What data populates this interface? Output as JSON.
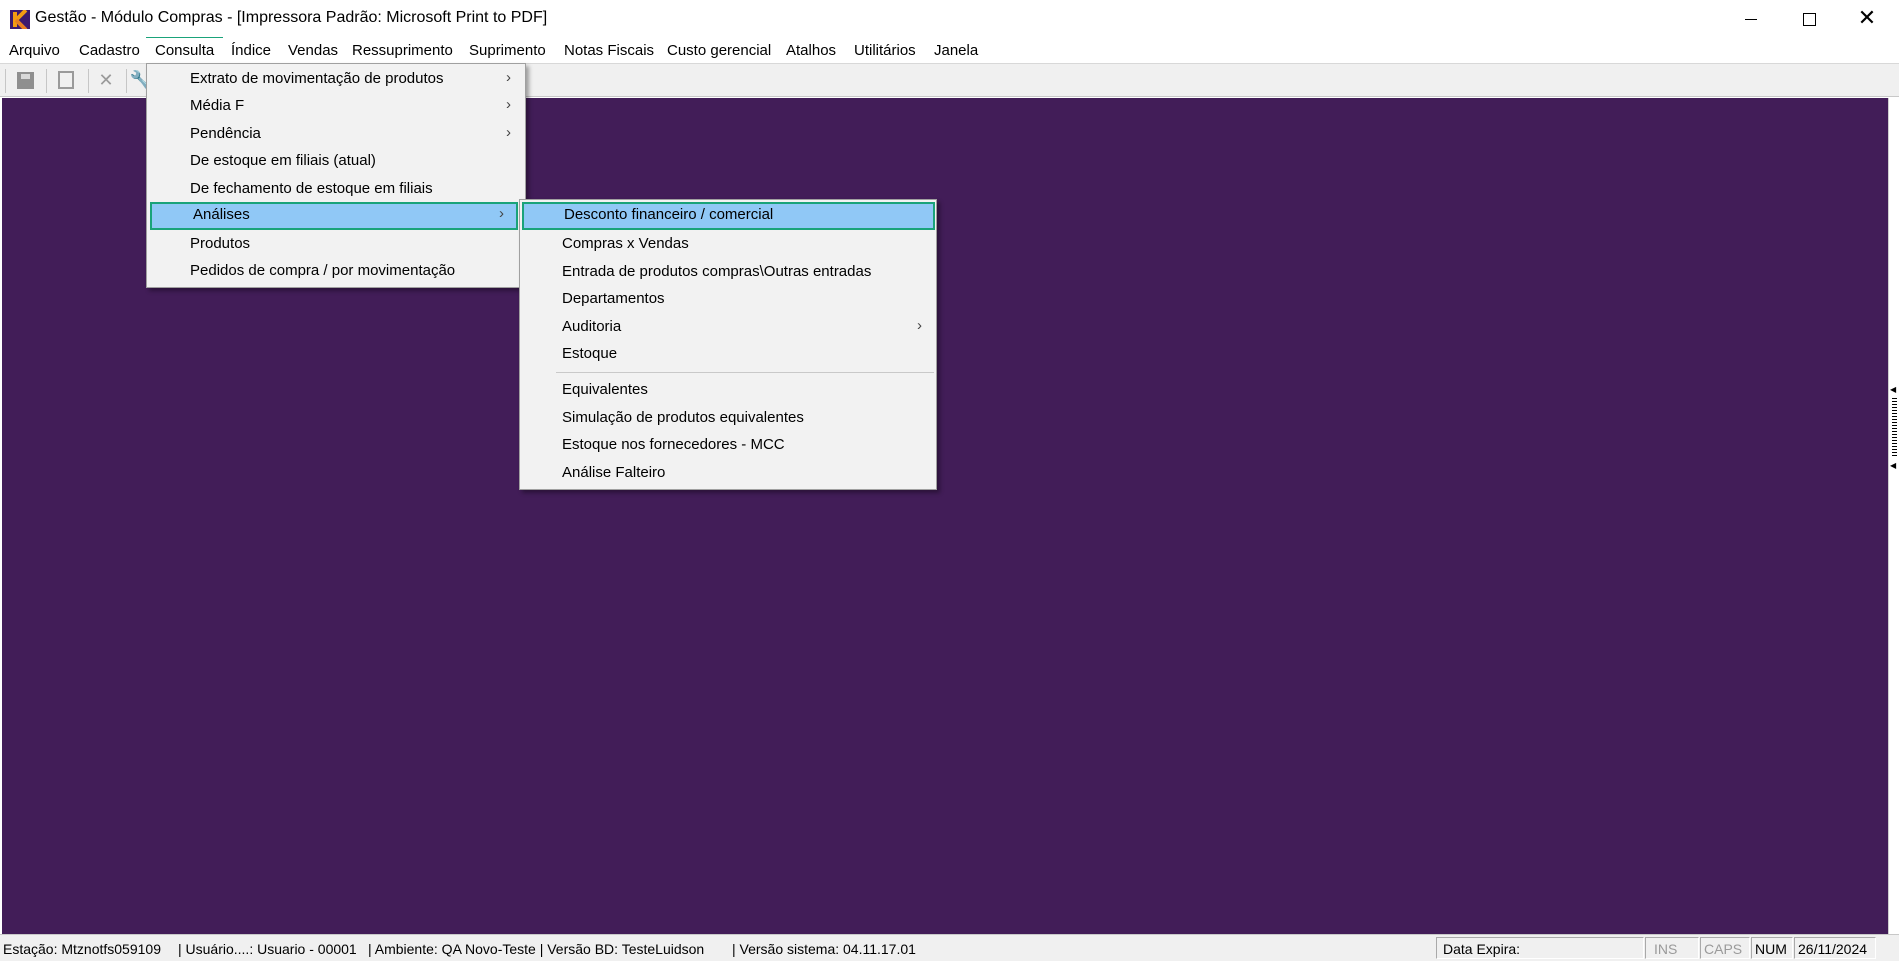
{
  "window": {
    "title": "Gestão  - Módulo Compras - [Impressora Padrão: Microsoft Print to PDF]",
    "icon": "app-logo-icon",
    "controls": [
      "minimize",
      "maximize",
      "close"
    ]
  },
  "menubar": {
    "items": [
      "Arquivo",
      "Cadastro",
      "Consulta",
      "Índice",
      "Vendas",
      "Ressuprimento",
      "Suprimento",
      "Notas Fiscais",
      "Custo gerencial",
      "Atalhos",
      "Utilitários",
      "Janela"
    ],
    "active": "Consulta"
  },
  "toolbar": {
    "icons": [
      "save-icon",
      "document-icon",
      "delete-icon",
      "tool-icon"
    ]
  },
  "consulta_menu": {
    "items": [
      {
        "label": "Extrato de movimentação de produtos",
        "submenu": true
      },
      {
        "label": "Média F",
        "submenu": true
      },
      {
        "label": "Pendência",
        "submenu": true
      },
      {
        "label": "De estoque em filiais (atual)",
        "submenu": false
      },
      {
        "label": "De fechamento de estoque em filiais",
        "submenu": false
      },
      {
        "label": "Análises",
        "submenu": true,
        "highlighted": true
      },
      {
        "label": "Produtos",
        "submenu": false
      },
      {
        "label": "Pedidos de compra / por movimentação",
        "submenu": false
      }
    ],
    "arrow": "›"
  },
  "analises_menu": {
    "items": [
      {
        "label": "Desconto financeiro / comercial",
        "submenu": false,
        "highlighted": true
      },
      {
        "label": "Compras x Vendas",
        "submenu": false
      },
      {
        "label": "Entrada de produtos compras\\Outras entradas",
        "submenu": false
      },
      {
        "label": "Departamentos",
        "submenu": false
      },
      {
        "label": "Auditoria",
        "submenu": true
      },
      {
        "label": "Estoque",
        "submenu": false
      },
      {
        "label": "Equivalentes",
        "submenu": false
      },
      {
        "label": "Simulação de produtos equivalentes",
        "submenu": false
      },
      {
        "label": "Estoque nos fornecedores - MCC",
        "submenu": false
      },
      {
        "label": "Análise Falteiro",
        "submenu": false
      }
    ]
  },
  "statusbar": {
    "estacao": "Estação: Mtznotfs059109",
    "usuario": "| Usuário....: Usuario - 00001",
    "ambiente": "| Ambiente: QA Novo-Teste | Versão BD: TesteLuidson",
    "versao": "| Versão sistema: 04.11.17.01",
    "data_expira": "Data Expira:",
    "ins": "INS",
    "caps": "CAPS",
    "num": "NUM",
    "date": "26/11/2024"
  },
  "colors": {
    "workspace": "#421d58",
    "highlight": "#90c8f6",
    "focus_border": "#1aa37a"
  }
}
